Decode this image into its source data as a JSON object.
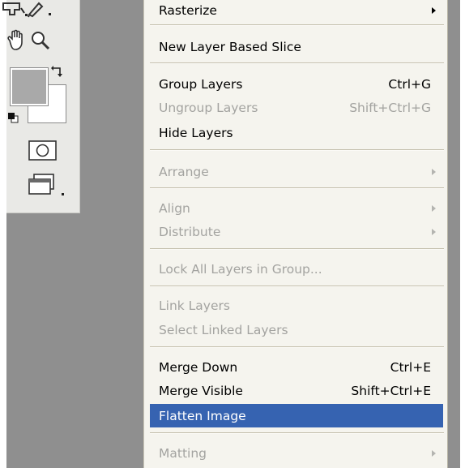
{
  "menu": {
    "items": [
      {
        "label": "Rasterize",
        "shortcut": "",
        "submenu": true,
        "disabled": false
      },
      {
        "label": "New Layer Based Slice",
        "shortcut": "",
        "submenu": false,
        "disabled": false
      },
      {
        "label": "Group Layers",
        "shortcut": "Ctrl+G",
        "submenu": false,
        "disabled": false
      },
      {
        "label": "Ungroup Layers",
        "shortcut": "Shift+Ctrl+G",
        "submenu": false,
        "disabled": true
      },
      {
        "label": "Hide Layers",
        "shortcut": "",
        "submenu": false,
        "disabled": false
      },
      {
        "label": "Arrange",
        "shortcut": "",
        "submenu": true,
        "disabled": true
      },
      {
        "label": "Align",
        "shortcut": "",
        "submenu": true,
        "disabled": true
      },
      {
        "label": "Distribute",
        "shortcut": "",
        "submenu": true,
        "disabled": true
      },
      {
        "label": "Lock All Layers in Group...",
        "shortcut": "",
        "submenu": false,
        "disabled": true
      },
      {
        "label": "Link Layers",
        "shortcut": "",
        "submenu": false,
        "disabled": true
      },
      {
        "label": "Select Linked Layers",
        "shortcut": "",
        "submenu": false,
        "disabled": true
      },
      {
        "label": "Merge Down",
        "shortcut": "Ctrl+E",
        "submenu": false,
        "disabled": false
      },
      {
        "label": "Merge Visible",
        "shortcut": "Shift+Ctrl+E",
        "submenu": false,
        "disabled": false
      },
      {
        "label": "Flatten Image",
        "shortcut": "",
        "submenu": false,
        "disabled": false,
        "highlighted": true
      },
      {
        "label": "Matting",
        "shortcut": "",
        "submenu": true,
        "disabled": true
      }
    ]
  },
  "toolbox": {
    "icons": [
      "brush-icon",
      "pen-icon",
      "hand-icon",
      "zoom-icon",
      "swap-colors-icon",
      "default-colors-icon",
      "quick-mask-icon",
      "screen-mode-icon"
    ],
    "foreground_color": "#a9a9a9",
    "background_color": "#ffffff"
  },
  "colors": {
    "highlight": "#3663b1",
    "workspace": "#8f8f8f",
    "menu_background": "#f5f4ee",
    "disabled_text": "#a3a3a0"
  }
}
